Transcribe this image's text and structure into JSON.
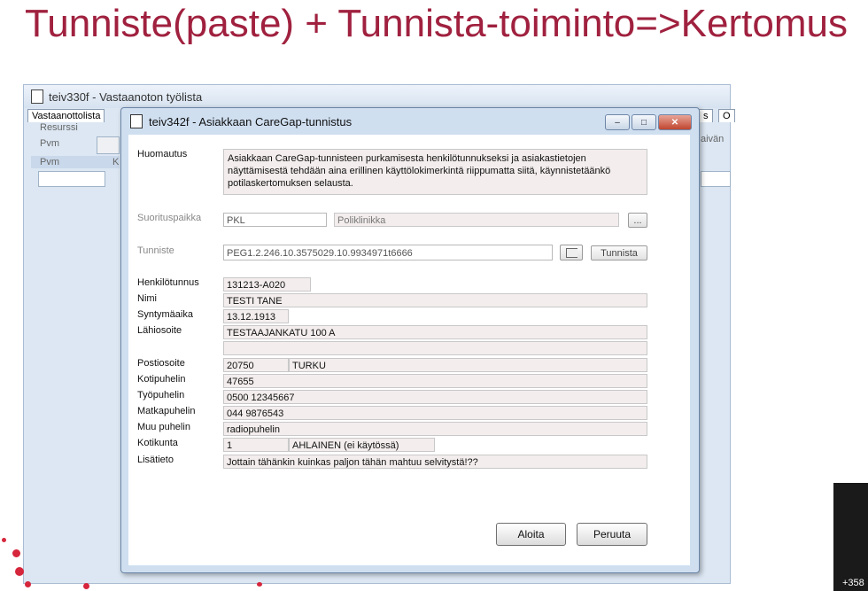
{
  "slide": {
    "title": "Tunniste(paste) + Tunnista-toiminto=>Kertomus"
  },
  "bg_window": {
    "title": "teiv330f - Vastaanoton työlista",
    "tab": "Vastaanottolista",
    "resurssi": "Resurssi",
    "pvm1": "Pvm",
    "pvm2": "Pvm",
    "col_k": "K",
    "right_tab_s": "s",
    "right_tab_o": "O",
    "paivan": "aivän"
  },
  "dialog": {
    "title": "teiv342f - Asiakkaan CareGap-tunnistus",
    "win_min": "‒",
    "win_max": "□",
    "win_close": "✕",
    "huomautus_label": "Huomautus",
    "huomautus_text": "Asiakkaan CareGap-tunnisteen purkamisesta henkilötunnukseksi ja asiakastietojen näyttämisestä tehdään aina erillinen käyttölokimerkintä riippumatta siitä, käynnistetäänkö potilaskertomuksen selausta.",
    "suorituspaikka_label": "Suorituspaikka",
    "suorituspaikka_code": "PKL",
    "suorituspaikka_name": "Poliklinikka",
    "ellipsis": "...",
    "tunniste_label": "Tunniste",
    "tunniste_value": "PEG1.2.246.10.3575029.10.9934971t6666",
    "tunnista_button": "Tunnista",
    "henkilotunnus_label": "Henkilötunnus",
    "henkilotunnus": "131213-A020",
    "nimi_label": "Nimi",
    "nimi": "TESTI TANE",
    "syntymaaika_label": "Syntymäaika",
    "syntymaaika": "13.12.1913",
    "lahiosoite_label": "Lähiosoite",
    "lahiosoite": "TESTAAJANKATU 100 A",
    "lahiosoite2": "",
    "postiosoite_label": "Postiosoite",
    "postinumero": "20750",
    "postitoimipaikka": "TURKU",
    "kotipuhelin_label": "Kotipuhelin",
    "kotipuhelin": "47655",
    "tyopuhelin_label": "Työpuhelin",
    "tyopuhelin": "0500 12345667",
    "matkapuhelin_label": "Matkapuhelin",
    "matkapuhelin": "044 9876543",
    "muu_puhelin_label": "Muu puhelin",
    "muu_puhelin": "radiopuhelin",
    "kotikunta_label": "Kotikunta",
    "kotikunta_code": "1",
    "kotikunta_name": "AHLAINEN (ei käytössä)",
    "lisatieto_label": "Lisätieto",
    "lisatieto": "Jottain tähänkin kuinkas paljon tähän mahtuu selvitystä!??",
    "aloita_button": "Aloita",
    "peruuta_button": "Peruuta"
  },
  "footer": {
    "phone": "+358"
  },
  "colors": {
    "title": "#a0213f",
    "accent_dots": "#d6263c"
  }
}
